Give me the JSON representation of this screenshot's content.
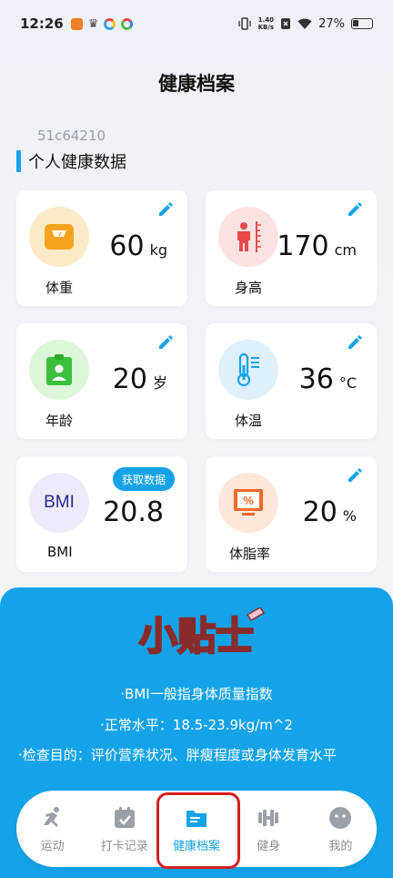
{
  "status_bar": {
    "time": "12:26",
    "speed_value": "1.40",
    "speed_unit": "KB/s",
    "battery": "27%"
  },
  "page": {
    "title": "健康档案",
    "user_id": "51c64210",
    "section_title": "个人健康数据"
  },
  "cards": {
    "weight": {
      "label": "体重",
      "value": "60",
      "unit": "kg",
      "icon": "scale-icon",
      "color": "#fbe9c7"
    },
    "height": {
      "label": "身高",
      "value": "170",
      "unit": "cm",
      "icon": "person-ruler-icon",
      "color": "#fde2e2"
    },
    "age": {
      "label": "年龄",
      "value": "20",
      "unit": "岁",
      "icon": "id-badge-icon",
      "color": "#ddf5d8"
    },
    "temperature": {
      "label": "体温",
      "value": "36",
      "unit": "°C",
      "icon": "thermometer-icon",
      "color": "#dff0fb"
    },
    "bmi": {
      "label": "BMI",
      "value": "20.8",
      "icon_text": "BMI",
      "button": "获取数据",
      "color": "#ecebfb"
    },
    "body_fat": {
      "label": "体脂率",
      "value": "20",
      "unit": "%",
      "icon": "percent-screen-icon",
      "color": "#fde6dc"
    }
  },
  "tips": {
    "logo_text": "小贴士",
    "line1": "·BMI一般指身体质量指数",
    "line2": "·正常水平：18.5-23.9kg/m^2",
    "line3": "·检查目的：评价营养状况、胖瘦程度或身体发育水平"
  },
  "nav": {
    "items": [
      {
        "label": "运动",
        "icon": "running-icon"
      },
      {
        "label": "打卡记录",
        "icon": "calendar-check-icon"
      },
      {
        "label": "健康档案",
        "icon": "folder-icon",
        "active": true
      },
      {
        "label": "健身",
        "icon": "dumbbell-icon"
      },
      {
        "label": "我的",
        "icon": "smiley-icon"
      }
    ]
  },
  "colors": {
    "accent": "#14a3e8",
    "highlight": "#d42020"
  }
}
